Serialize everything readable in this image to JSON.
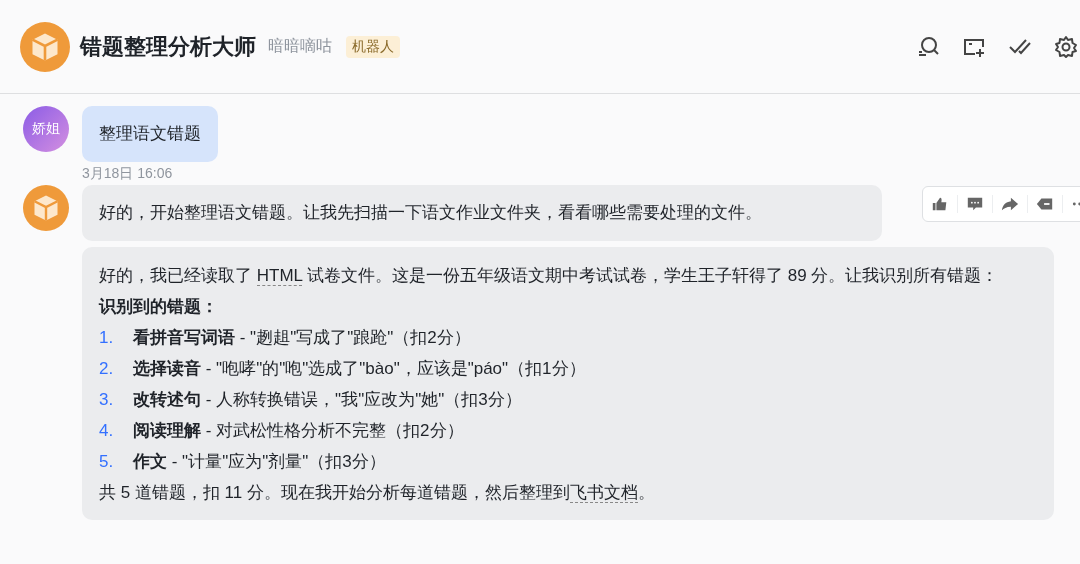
{
  "header": {
    "title": "错题整理分析大师",
    "subtitle": "暗暗嘀咕",
    "badge": "机器人"
  },
  "messages": [
    {
      "kind": "user",
      "avatar": "娇姐",
      "text": "整理语文错题"
    },
    {
      "kind": "time",
      "text": "3月18日 16:06"
    },
    {
      "kind": "bot",
      "text": "好的，开始整理语文错题。让我先扫描一下语文作业文件夹，看看哪些需要处理的文件。",
      "actions": true
    },
    {
      "kind": "bot-rich",
      "intro": [
        {
          "text": "好的，我已经读取了 ",
          "term": false
        },
        {
          "text": "HTML",
          "term": true
        },
        {
          "text": " 试卷文件。这是一份五年级语文期中考试试卷，学生王子轩得了 89 分。让我识别所有错题：",
          "term": false
        }
      ],
      "heading": "识别到的错题：",
      "items": [
        {
          "num": "1.",
          "title": "看拼音写词语",
          "text": " - \"趔趄\"写成了\"踉跄\"（扣2分）"
        },
        {
          "num": "2.",
          "title": "选择读音",
          "text": " - \"咆哮\"的\"咆\"选成了\"bào\"，应该是\"páo\"（扣1分）"
        },
        {
          "num": "3.",
          "title": "改转述句",
          "text": " - 人称转换错误，\"我\"应改为\"她\"（扣3分）"
        },
        {
          "num": "4.",
          "title": "阅读理解",
          "text": " - 对武松性格分析不完整（扣2分）"
        },
        {
          "num": "5.",
          "title": "作文",
          "text": " - \"计量\"应为\"剂量\"（扣3分）"
        }
      ],
      "outro": [
        {
          "text": "共 5 道错题，扣 11 分。现在我开始分析每道错题，然后整理到",
          "term": false
        },
        {
          "text": "飞书文档",
          "term": true
        },
        {
          "text": "。",
          "term": false
        }
      ]
    }
  ]
}
